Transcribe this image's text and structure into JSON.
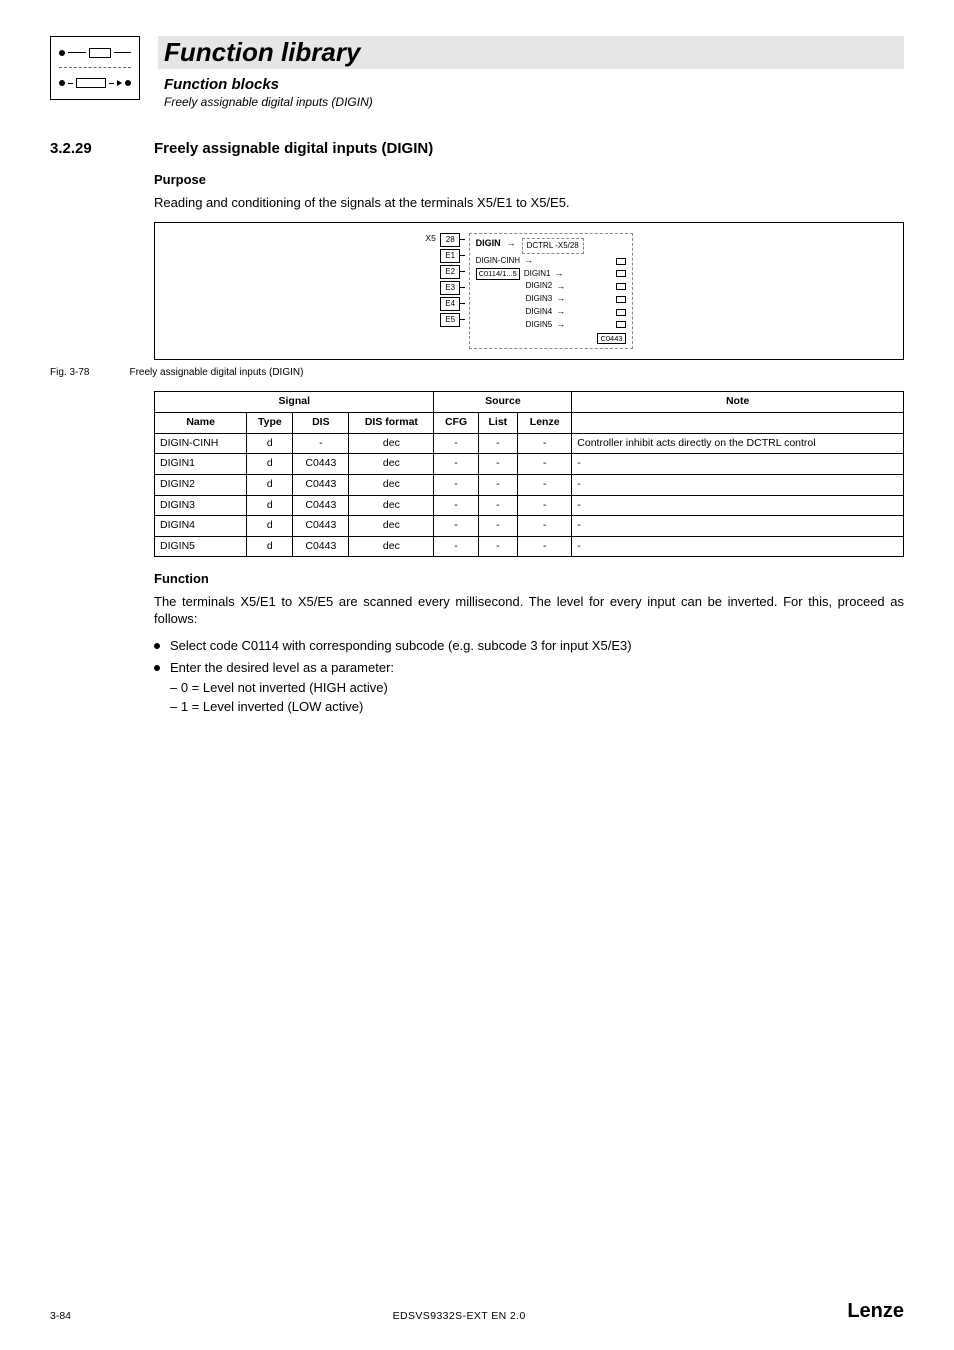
{
  "header": {
    "title": "Function library",
    "subtitle": "Function blocks",
    "subsubtitle": "Freely assignable digital inputs (DIGIN)"
  },
  "section": {
    "number": "3.2.29",
    "title": "Freely assignable digital inputs (DIGIN)"
  },
  "purpose_label": "Purpose",
  "purpose_text": "Reading and conditioning of the signals at the terminals X5/E1 to X5/E5.",
  "figure": {
    "x5_label": "X5",
    "terminals": [
      "28",
      "E1",
      "E2",
      "E3",
      "E4",
      "E5"
    ],
    "block_name": "DIGIN",
    "dctrl": "DCTRL -X5/28",
    "cinh": "DIGIN-CINH",
    "code_box": "C0114/1...5",
    "outputs": [
      "DIGIN1",
      "DIGIN2",
      "DIGIN3",
      "DIGIN4",
      "DIGIN5"
    ],
    "status_box": "C0443"
  },
  "fig_caption": {
    "id": "Fig. 3-78",
    "text": "Freely assignable digital inputs (DIGIN)"
  },
  "table": {
    "head_groups": [
      "Signal",
      "Source",
      "Note"
    ],
    "head_cols": [
      "Name",
      "Type",
      "DIS",
      "DIS format",
      "CFG",
      "List",
      "Lenze"
    ],
    "rows": [
      {
        "name": "DIGIN-CINH",
        "type": "d",
        "dis": "-",
        "disfmt": "dec",
        "cfg": "-",
        "list": "-",
        "lenze": "-",
        "note": "Controller inhibit acts directly on the DCTRL control"
      },
      {
        "name": "DIGIN1",
        "type": "d",
        "dis": "C0443",
        "disfmt": "dec",
        "cfg": "-",
        "list": "-",
        "lenze": "-",
        "note": "-"
      },
      {
        "name": "DIGIN2",
        "type": "d",
        "dis": "C0443",
        "disfmt": "dec",
        "cfg": "-",
        "list": "-",
        "lenze": "-",
        "note": "-"
      },
      {
        "name": "DIGIN3",
        "type": "d",
        "dis": "C0443",
        "disfmt": "dec",
        "cfg": "-",
        "list": "-",
        "lenze": "-",
        "note": "-"
      },
      {
        "name": "DIGIN4",
        "type": "d",
        "dis": "C0443",
        "disfmt": "dec",
        "cfg": "-",
        "list": "-",
        "lenze": "-",
        "note": "-"
      },
      {
        "name": "DIGIN5",
        "type": "d",
        "dis": "C0443",
        "disfmt": "dec",
        "cfg": "-",
        "list": "-",
        "lenze": "-",
        "note": "-"
      }
    ]
  },
  "function_label": "Function",
  "function_text": "The terminals X5/E1 to X5/E5 are scanned every millisecond. The level for every input can be inverted. For this, proceed as follows:",
  "bullets": [
    {
      "text": "Select code C0114 with corresponding subcode (e.g. subcode 3 for input X5/E3)"
    },
    {
      "text": "Enter the desired level as a parameter:",
      "sub": [
        "0 = Level not inverted (HIGH active)",
        "1 = Level inverted (LOW active)"
      ]
    }
  ],
  "footer": {
    "page": "3-84",
    "docid": "EDSVS9332S-EXT EN 2.0",
    "brand": "Lenze"
  }
}
